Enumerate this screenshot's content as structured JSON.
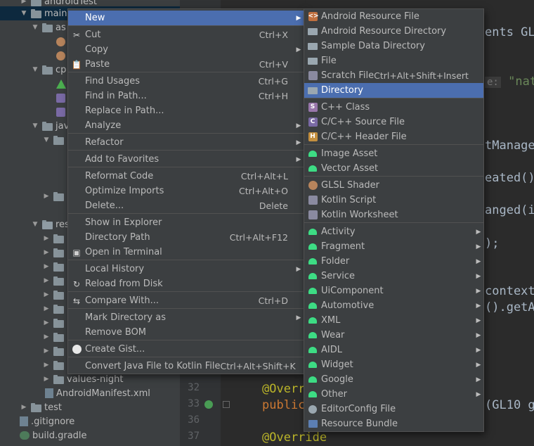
{
  "tree": {
    "top_partial_label": "androidTest",
    "selected_label": "main",
    "truncated_labels": [
      "as",
      "cp",
      "jav",
      "res"
    ],
    "values_night": "values-night",
    "manifest": "AndroidManifest.xml",
    "test": "test",
    "gitignore": ".gitignore",
    "build_gradle": "build.gradle"
  },
  "editor": {
    "lines": [
      {
        "num": "32",
        "text": "@Overr"
      },
      {
        "num": "33",
        "text": "public"
      },
      {
        "num": "36",
        "text": ""
      },
      {
        "num": "37",
        "text": "@Override"
      }
    ],
    "fragments": {
      "implements": "ents GLS",
      "hint": "e:",
      "hint_str": "\"nati",
      "manage": "tManage",
      "created": "eated()",
      "changed": "anged(i",
      "paren": ");",
      "context": "context)",
      "geta": "().getA",
      "gl10": "(GL10 g"
    }
  },
  "main_menu": {
    "items": [
      {
        "icon": "",
        "label": "New",
        "shortcut": "",
        "submenu": true
      },
      {
        "icon": "scissors-icon",
        "label": "Cut",
        "shortcut": "Ctrl+X",
        "submenu": false
      },
      {
        "icon": "",
        "label": "Copy",
        "shortcut": "",
        "submenu": true
      },
      {
        "icon": "paste-icon",
        "label": "Paste",
        "shortcut": "Ctrl+V",
        "submenu": false
      },
      {
        "icon": "",
        "label": "Find Usages",
        "shortcut": "Ctrl+G",
        "submenu": false
      },
      {
        "icon": "",
        "label": "Find in Path...",
        "shortcut": "Ctrl+H",
        "submenu": false
      },
      {
        "icon": "",
        "label": "Replace in Path...",
        "shortcut": "",
        "submenu": false
      },
      {
        "icon": "",
        "label": "Analyze",
        "shortcut": "",
        "submenu": true
      },
      {
        "icon": "",
        "label": "Refactor",
        "shortcut": "",
        "submenu": true
      },
      {
        "icon": "",
        "label": "Add to Favorites",
        "shortcut": "",
        "submenu": true
      },
      {
        "icon": "",
        "label": "Reformat Code",
        "shortcut": "Ctrl+Alt+L",
        "submenu": false
      },
      {
        "icon": "",
        "label": "Optimize Imports",
        "shortcut": "Ctrl+Alt+O",
        "submenu": false
      },
      {
        "icon": "",
        "label": "Delete...",
        "shortcut": "Delete",
        "submenu": false
      },
      {
        "icon": "",
        "label": "Show in Explorer",
        "shortcut": "",
        "submenu": false
      },
      {
        "icon": "",
        "label": "Directory Path",
        "shortcut": "Ctrl+Alt+F12",
        "submenu": false
      },
      {
        "icon": "terminal-icon",
        "label": "Open in Terminal",
        "shortcut": "",
        "submenu": false
      },
      {
        "icon": "",
        "label": "Local History",
        "shortcut": "",
        "submenu": true
      },
      {
        "icon": "reload-icon",
        "label": "Reload from Disk",
        "shortcut": "",
        "submenu": false
      },
      {
        "icon": "compare-icon",
        "label": "Compare With...",
        "shortcut": "Ctrl+D",
        "submenu": false
      },
      {
        "icon": "",
        "label": "Mark Directory as",
        "shortcut": "",
        "submenu": true
      },
      {
        "icon": "",
        "label": "Remove BOM",
        "shortcut": "",
        "submenu": false
      },
      {
        "icon": "github-icon",
        "label": "Create Gist...",
        "shortcut": "",
        "submenu": false
      },
      {
        "icon": "",
        "label": "Convert Java File to Kotlin File",
        "shortcut": "Ctrl+Alt+Shift+K",
        "submenu": false
      }
    ]
  },
  "new_menu": {
    "items": [
      {
        "icon": "resource-file-icon",
        "label": "Android Resource File",
        "shortcut": "",
        "submenu": false
      },
      {
        "icon": "folder-icon",
        "label": "Android Resource Directory",
        "shortcut": "",
        "submenu": false
      },
      {
        "icon": "folder-icon",
        "label": "Sample Data Directory",
        "shortcut": "",
        "submenu": false
      },
      {
        "icon": "file-icon",
        "label": "File",
        "shortcut": "",
        "submenu": false
      },
      {
        "icon": "scratch-file-icon",
        "label": "Scratch File",
        "shortcut": "Ctrl+Alt+Shift+Insert",
        "submenu": false
      },
      {
        "icon": "folder-icon",
        "label": "Directory",
        "shortcut": "",
        "submenu": false
      },
      {
        "icon": "cpp-class-icon",
        "label": "C++ Class",
        "shortcut": "",
        "submenu": false
      },
      {
        "icon": "cpp-source-icon",
        "label": "C/C++ Source File",
        "shortcut": "",
        "submenu": false
      },
      {
        "icon": "cpp-header-icon",
        "label": "C/C++ Header File",
        "shortcut": "",
        "submenu": false
      },
      {
        "icon": "android-icon",
        "label": "Image Asset",
        "shortcut": "",
        "submenu": false
      },
      {
        "icon": "android-icon",
        "label": "Vector Asset",
        "shortcut": "",
        "submenu": false
      },
      {
        "icon": "glsl-icon",
        "label": "GLSL Shader",
        "shortcut": "",
        "submenu": false
      },
      {
        "icon": "kotlin-script-icon",
        "label": "Kotlin Script",
        "shortcut": "",
        "submenu": false
      },
      {
        "icon": "kotlin-worksheet-icon",
        "label": "Kotlin Worksheet",
        "shortcut": "",
        "submenu": false
      },
      {
        "icon": "android-icon",
        "label": "Activity",
        "shortcut": "",
        "submenu": true
      },
      {
        "icon": "android-icon",
        "label": "Fragment",
        "shortcut": "",
        "submenu": true
      },
      {
        "icon": "android-icon",
        "label": "Folder",
        "shortcut": "",
        "submenu": true
      },
      {
        "icon": "android-icon",
        "label": "Service",
        "shortcut": "",
        "submenu": true
      },
      {
        "icon": "android-icon",
        "label": "UiComponent",
        "shortcut": "",
        "submenu": true
      },
      {
        "icon": "android-icon",
        "label": "Automotive",
        "shortcut": "",
        "submenu": true
      },
      {
        "icon": "android-icon",
        "label": "XML",
        "shortcut": "",
        "submenu": true
      },
      {
        "icon": "android-icon",
        "label": "Wear",
        "shortcut": "",
        "submenu": true
      },
      {
        "icon": "android-icon",
        "label": "AIDL",
        "shortcut": "",
        "submenu": true
      },
      {
        "icon": "android-icon",
        "label": "Widget",
        "shortcut": "",
        "submenu": true
      },
      {
        "icon": "android-icon",
        "label": "Google",
        "shortcut": "",
        "submenu": true
      },
      {
        "icon": "android-icon",
        "label": "Other",
        "shortcut": "",
        "submenu": true
      },
      {
        "icon": "gear-icon",
        "label": "EditorConfig File",
        "shortcut": "",
        "submenu": false
      },
      {
        "icon": "resource-bundle-icon",
        "label": "Resource Bundle",
        "shortcut": "",
        "submenu": false
      }
    ]
  },
  "colors": {
    "highlight": "#4b6eaf",
    "menu_bg": "#3c3f41",
    "editor_bg": "#2b2b2b",
    "android_green": "#3ddc84"
  }
}
